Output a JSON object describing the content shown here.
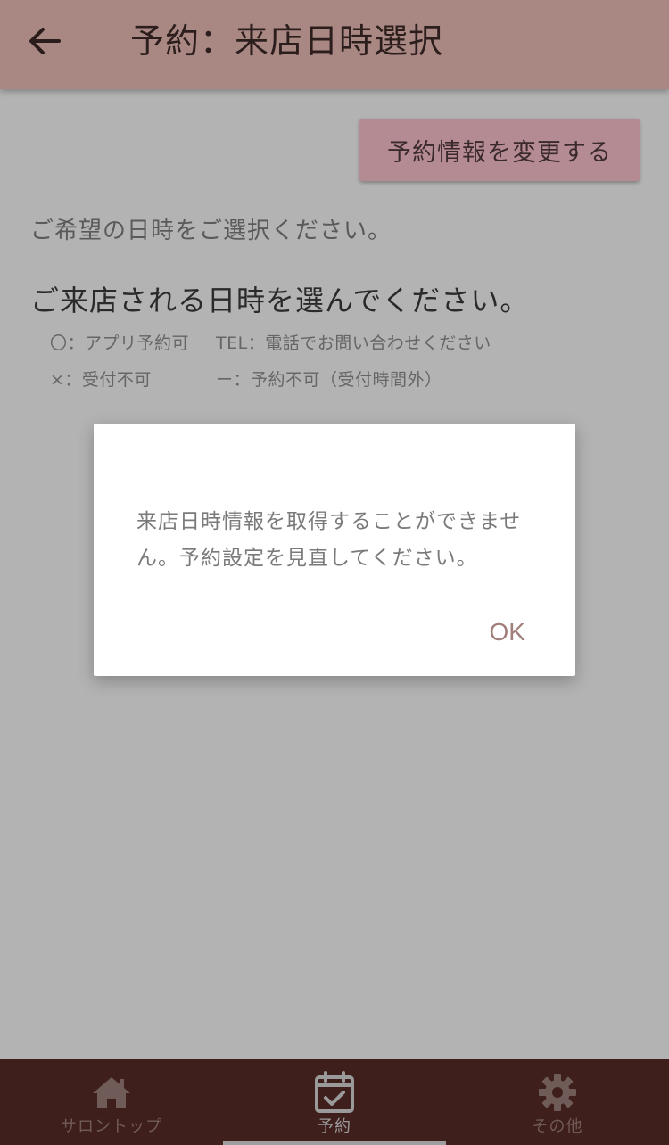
{
  "header": {
    "title": "予約：来店日時選択"
  },
  "actions": {
    "change_label": "予約情報を変更する"
  },
  "main": {
    "instruction": "ご希望の日時をご選択ください。",
    "heading": "ご来店される日時を選んでください。",
    "legend": {
      "app": "〇：アプリ予約可",
      "tel": "TEL：電話でお問い合わせください",
      "unavailable": "×：受付不可",
      "out_of_hours": "ー：予約不可（受付時間外）"
    }
  },
  "dialog": {
    "message": "来店日時情報を取得することができません。予約設定を見直してください。",
    "ok_label": "OK"
  },
  "bottom_nav": {
    "items": [
      {
        "label": "サロントップ",
        "icon": "home-icon"
      },
      {
        "label": "予約",
        "icon": "calendar-check-icon"
      },
      {
        "label": "その他",
        "icon": "gear-icon"
      }
    ],
    "active_index": 1
  },
  "colors": {
    "header_bg": "#a98883",
    "button_bg": "#b48b93",
    "nav_bg": "#3f1f1c",
    "ok_text": "#a07e7b"
  }
}
